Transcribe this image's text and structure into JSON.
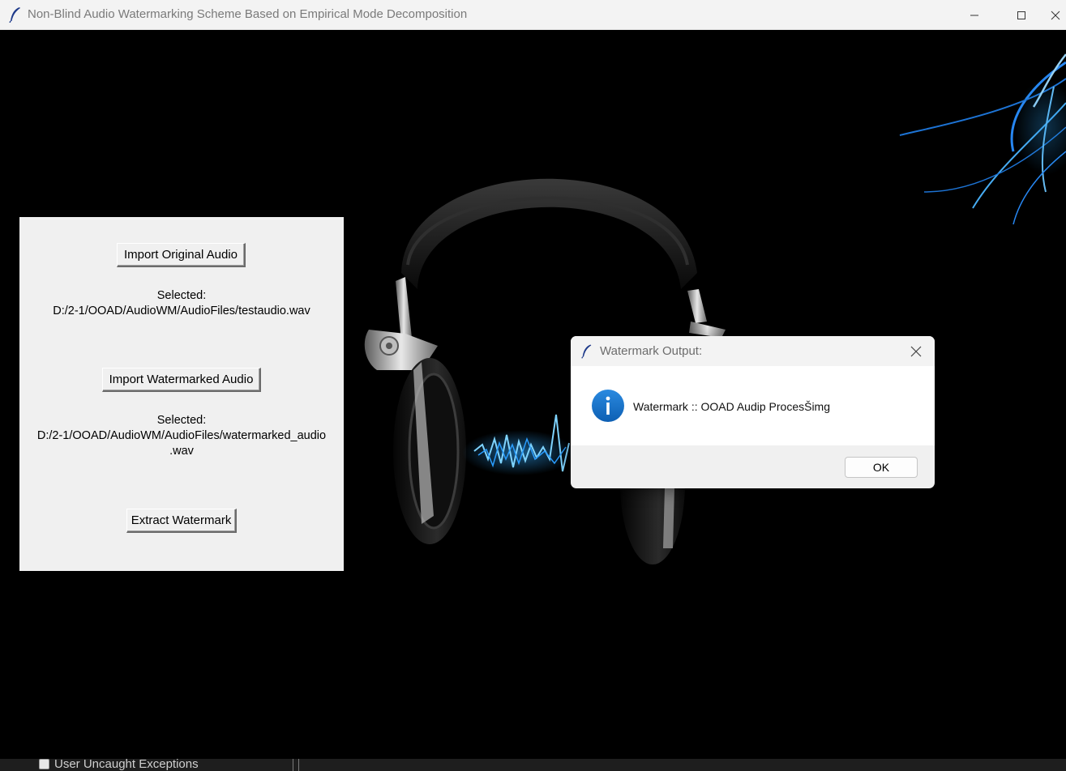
{
  "window": {
    "title": "Non-Blind Audio Watermarking Scheme Based on Empirical Mode Decomposition"
  },
  "panel": {
    "import_original_label": "Import Original Audio",
    "selected_original_line1": "Selected:",
    "selected_original_line2": "D:/2-1/OOAD/AudioWM/AudioFiles/testaudio.wav",
    "import_watermarked_label": "Import Watermarked Audio",
    "selected_watermarked_line1": "Selected:",
    "selected_watermarked_line2": "D:/2-1/OOAD/AudioWM/AudioFiles/watermarked_audio",
    "selected_watermarked_line3": ".wav",
    "extract_label": "Extract Watermark"
  },
  "dialog": {
    "title": "Watermark Output:",
    "message": "Watermark  :: OOAD Audip ProcesŠimg",
    "ok_label": "OK"
  },
  "bottom": {
    "exceptions_label": "User Uncaught Exceptions"
  },
  "colors": {
    "background": "#000000",
    "panel": "#f0f0f0",
    "info_icon": "#1a73c8",
    "glow": "#2fa8ff"
  }
}
